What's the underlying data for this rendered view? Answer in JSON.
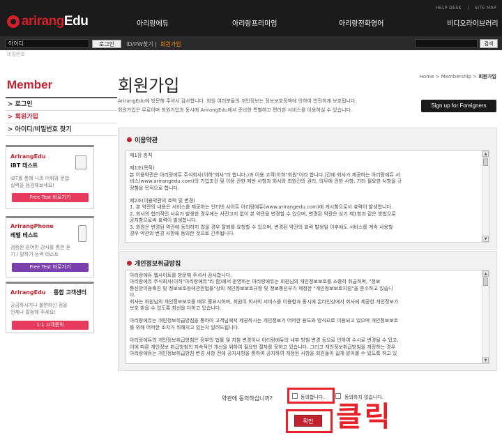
{
  "header": {
    "logo_a": "arirang",
    "logo_b": "Edu",
    "util_links": [
      "HELP DESK",
      "|",
      "SITE MAP"
    ],
    "nav": [
      "아리랑에듀",
      "아리랑프리미엄",
      "아리랑전화영어",
      "비디오라이브러리"
    ]
  },
  "loginbar": {
    "id_placeholder": "아이디",
    "pw_placeholder": "비밀번호",
    "login_label": "로그인",
    "find_label": "ID/PW찾기 |",
    "join_label": "회원가입",
    "search_label": "검색"
  },
  "sidebar": {
    "title": "Member",
    "items": [
      "> 로그인",
      "> 회원가입",
      "> 아이디/비밀번호 찾기"
    ],
    "promos": [
      {
        "brand": "ArirangEdu",
        "sub": "iBT 테스트",
        "desc": "iBT를 통해 나의 어휘와 문법 실력을 점검해보세요!",
        "button": "Free Test 바로가기",
        "color": "#e83a5c"
      },
      {
        "brand": "ArirangPhone",
        "sub": "레벨 테스트",
        "desc": "검증된 원어민 강사를 통한 듣기 / 말하기 능력 테스트",
        "button": "Free Test 바로가기",
        "color": "#7b3fb0"
      },
      {
        "brand": "ArirangEdu",
        "sub": "통합 고객센터",
        "desc": "궁금하시거나 불편하신 점을 언제나 말씀해 주세요!",
        "button": "1:1 고객문의",
        "color": "#e83a5c"
      }
    ]
  },
  "main": {
    "breadcrumb": {
      "home": "Home",
      "sep": ">",
      "section": "Membership",
      "current": "회원가입"
    },
    "title": "회원가입",
    "intro1": "ArirangEdu에 방문해 주셔서 감사합니다. 회원 여러분들의 개인정보는 정보보호정책에 의하여 안전하게 보호됩니다.",
    "intro2": "회원가입은 무료이며 회원가입과 동시에 ArirangEdu에서 준비한 특별하고 편리한 서비스를 이용하실 수 있습니다.",
    "foreign_button": "Sign up for Foreigners",
    "terms": {
      "heading": "이용약관",
      "lines": [
        {
          "t": "제1장 총칙",
          "gap": false
        },
        {
          "t": "제1조(목적)",
          "gap": true
        },
        {
          "t": "본 이용약관은 아리랑에듀 주식회사(이하\"회사\"라 합니다.)과 이용 고객(이하\"회원\"이라 합니다.)간에 회사가 제공하는 아리랑에듀 서",
          "gap": false
        },
        {
          "t": "비스(www.arirangedu.com)의 가입조건 및 이용 관한 제반 사항과 회사와 회원간의 권리, 의무에 관한 사항, 기타 필요한 사항을 규",
          "gap": false
        },
        {
          "t": "정함을 목적으로 합니다.",
          "gap": false
        },
        {
          "t": "제2조(이용약관의 효력 및 변경)",
          "gap": true
        },
        {
          "t": "1. 본 약관의 내용은 서비스를 제공하는 인터넷 사이트 아리랑에듀(www.arirangedu.com)에 게시함으로서 효력이 발생합니다.",
          "gap": false
        },
        {
          "t": "2. 회사의 합리적인 사유가 발생한 경우에는 사전고지 없이 본 약관을 변경할 수 있으며, 변경된 약관은 상기 제1항과 같은 방법으로",
          "gap": false
        },
        {
          "t": "공지함으로써 효력이 발생합니다.",
          "gap": false
        },
        {
          "t": "3. 회원은 변경된 약관에 동의하지 않을 경우 탈퇴를 요청할 수 있으며, 변경된 약관의 효력 발생일 이후에도 서비스를 계속 사용할",
          "gap": false
        },
        {
          "t": "경우 약관의 변경 사항에 동의한 것으로 간주됩니다.",
          "gap": false
        }
      ]
    },
    "privacy": {
      "heading": "개인정보취급방침",
      "lines": [
        {
          "t": "아리랑에듀 웹사이트를 방문해 주셔서 감사합니다.",
          "gap": false
        },
        {
          "t": "아리랑에듀 주식회사(이하\"아리랑에듀\"라 함)에서 운영하는 아리랑에듀는 회원님의 개인정보보호를 소중히 취급하며, \"정보",
          "gap": false
        },
        {
          "t": "통신망이용촉진 및 정보보호등에관한법률\"상의 개인정보보호규정 및 정보통신부가 제정한 \"개인정보보호지침\"을 준수하고 있습니",
          "gap": false
        },
        {
          "t": "다.",
          "gap": false
        },
        {
          "t": "회사는 회원님의 개인정보보호를 매우 중요시하며, 회원이 회사의 서비스를 이용함과 동시에 온라인상에서 회사에 제공한 개인정보가",
          "gap": false
        },
        {
          "t": "보호 받을 수 있도록 최선을 다하고 있습니다.",
          "gap": false
        },
        {
          "t": "아리랑에듀는 개인정보취급방침을 통하여 고객님께서 제공하시는 개인정보가 어떠한 용도와 방식으로 이용되고 있으며 개인정보보호",
          "gap": true
        },
        {
          "t": "를 위해 어떠한 조치가 취해지고 있는지 알려드립니다.",
          "gap": false
        },
        {
          "t": "아리랑에듀의 개인정보취급방침은 정부의 법률 및 지침 변경이나 아리랑에듀의 내부 방침 변경 등으로 인하여 수시로 변경될 수 있고,",
          "gap": true
        },
        {
          "t": "이에 따른 개인정보 취급방침의 지속적인 개선을 위하여 필요한 절차를 정하고 있습니다. 그리고 개인정보취급방침을 개정하는 경우",
          "gap": false
        },
        {
          "t": "아리랑에듀는 개인정보취급방침 변경 사항 전에 공지사항을 통하여 공지하여 개정된 사항을 회원들이 쉽게 알아볼 수 있도록 하고 있",
          "gap": false
        }
      ]
    },
    "agree_question": "약관에 동의하십니까?",
    "agree_label": "동의합니다.",
    "disagree_label": "동의하지 않습니다.",
    "confirm_label": "확인",
    "annotation": "클릭"
  }
}
